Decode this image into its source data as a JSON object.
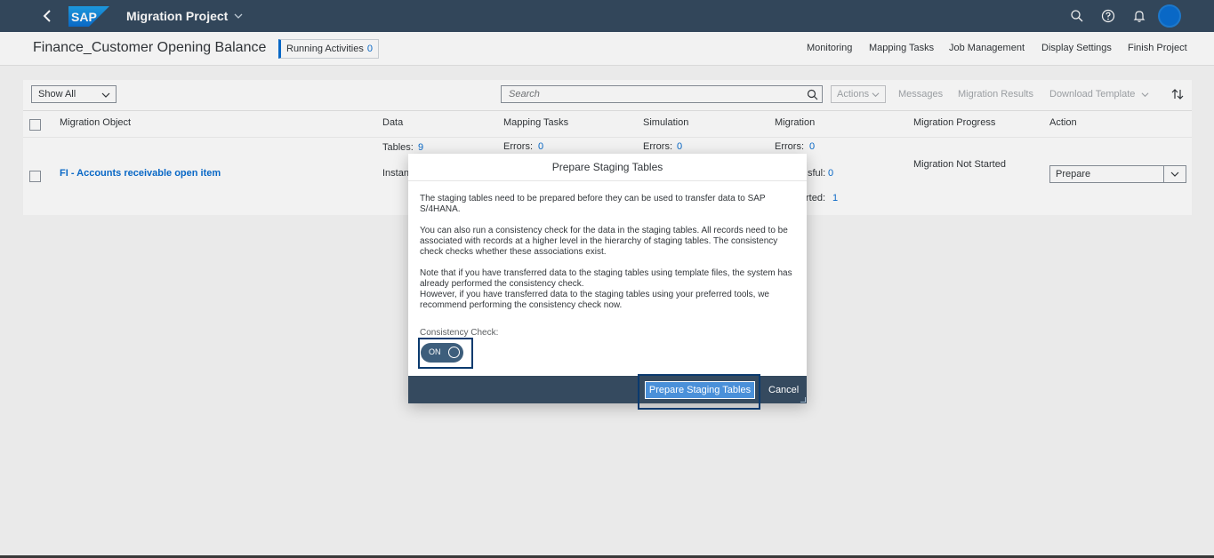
{
  "shell": {
    "title": "Migration Project",
    "brand": "SAP",
    "accent": "#354a5f"
  },
  "header": {
    "page_title": "Finance_Customer Opening Balance",
    "running_label": "Running Activities",
    "running_count": "0",
    "nav": [
      "Monitoring",
      "Mapping Tasks",
      "Job Management",
      "Display Settings",
      "Finish Project"
    ]
  },
  "toolbar": {
    "filter_value": "Show All",
    "search_placeholder": "Search",
    "actions_label": "Actions",
    "messages_label": "Messages",
    "results_label": "Migration Results",
    "download_label": "Download Template"
  },
  "table": {
    "columns": [
      "Migration Object",
      "Data",
      "Mapping Tasks",
      "Simulation",
      "Migration",
      "Migration Progress",
      "Action"
    ],
    "row": {
      "object": "FI - Accounts receivable open item",
      "tables_label": "Tables:",
      "tables_count": "9",
      "instances_label": "Instan",
      "mapping_errors_label": "Errors:",
      "mapping_errors": "0",
      "sim_errors_label": "Errors:",
      "sim_errors": "0",
      "mig_errors_label": "Errors:",
      "mig_errors": "0",
      "mig_success_label": "sful:",
      "mig_success": "0",
      "mig_notstarted_label": "rted:",
      "mig_notstarted": "1",
      "progress": "Migration Not Started",
      "action_value": "Prepare"
    }
  },
  "dialog": {
    "title": "Prepare Staging Tables",
    "p1": "The staging tables need to be prepared before they can be used to transfer data to SAP S/4HANA.",
    "p2": "You can also run a consistency check for the data in the staging tables. All records need to be associated with records at a higher level in the hierarchy of staging tables. The consistency check checks whether these associations exist.",
    "p3a": "Note that if you have transferred data to the staging tables using template files, the system has already performed the consistency check.",
    "p3b": "However, if you have transferred data to the staging tables using your preferred tools, we recommend performing the consistency check now.",
    "cc_label": "Consistency Check:",
    "switch_text": "ON",
    "prepare_label": "Prepare Staging Tables",
    "cancel_label": "Cancel"
  }
}
